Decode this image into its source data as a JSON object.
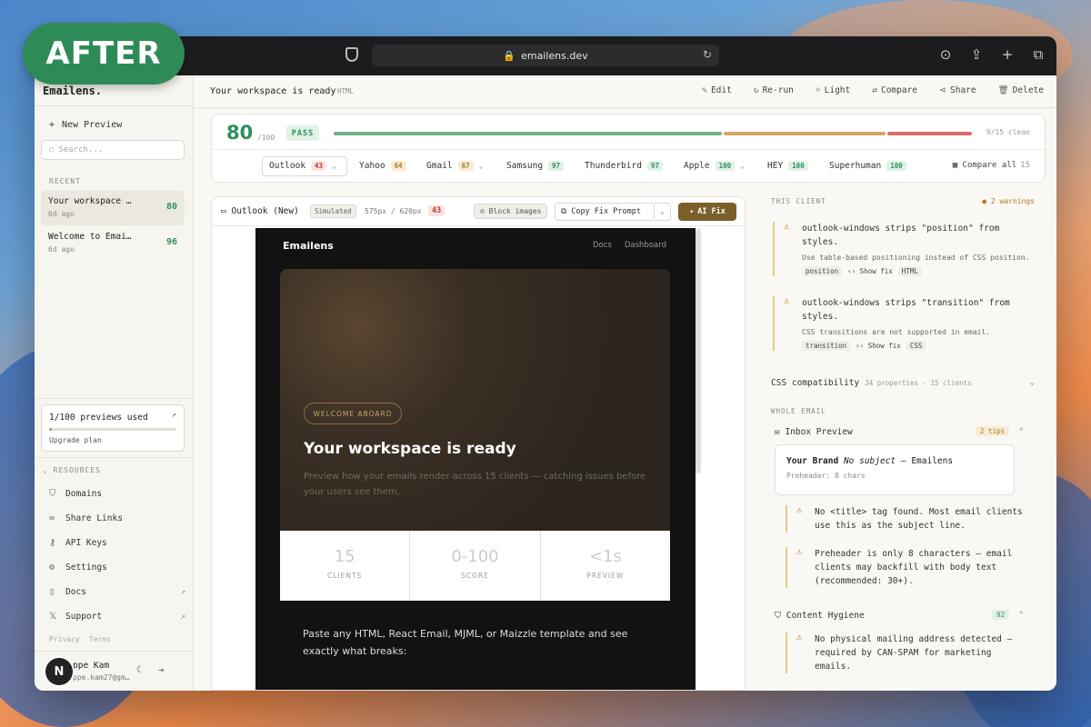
{
  "badge": "AFTER",
  "browser": {
    "url": "emailens.dev"
  },
  "sidebar": {
    "brand": "Emailens.",
    "new_preview": "New Preview",
    "search_placeholder": "Search...",
    "recent_label": "RECENT",
    "recent": [
      {
        "title": "Your workspace …",
        "date": "6d ago",
        "score": "80"
      },
      {
        "title": "Welcome to Emai…",
        "date": "6d ago",
        "score": "96"
      }
    ],
    "usage": {
      "text": "1/100 previews used",
      "upgrade": "Upgrade plan",
      "fraction": 0.01
    },
    "resources_label": "RESOURCES",
    "resources": [
      {
        "label": "Domains",
        "icon": "shield-icon"
      },
      {
        "label": "Share Links",
        "icon": "link-icon"
      },
      {
        "label": "API Keys",
        "icon": "key-icon"
      },
      {
        "label": "Settings",
        "icon": "gear-icon"
      },
      {
        "label": "Docs",
        "icon": "book-icon"
      },
      {
        "label": "Support",
        "icon": "x-icon"
      }
    ],
    "legal": [
      "Privacy",
      "Terms"
    ],
    "user": {
      "initial": "N",
      "name": "ppe Kam",
      "email": "ppe.kam27@gm…"
    }
  },
  "header": {
    "title": "Your workspace is ready",
    "type": "HTML",
    "actions": [
      "Edit",
      "Re-run",
      "Light",
      "Compare",
      "Share",
      "Delete"
    ]
  },
  "score": {
    "value": "80",
    "of": "/100",
    "status": "PASS",
    "clean": "9/15 clean",
    "segments": [
      {
        "fraction": 0.6,
        "color": "#6fb08a"
      },
      {
        "fraction": 0.25,
        "color": "#d4a862"
      },
      {
        "fraction": 0.13,
        "color": "#e06a66"
      }
    ],
    "clients": [
      {
        "name": "Outlook",
        "score": "43",
        "level": "red"
      },
      {
        "name": "Yahoo",
        "score": "64",
        "level": "amber"
      },
      {
        "name": "Gmail",
        "score": "67",
        "level": "amber"
      },
      {
        "name": "Samsung",
        "score": "97",
        "level": "green"
      },
      {
        "name": "Thunderbird",
        "score": "97",
        "level": "green"
      },
      {
        "name": "Apple",
        "score": "100",
        "level": "green"
      },
      {
        "name": "HEY",
        "score": "100",
        "level": "green"
      },
      {
        "name": "Superhuman",
        "score": "100",
        "level": "green"
      }
    ],
    "compare_all": "Compare all",
    "compare_count": "15"
  },
  "preview": {
    "client": "Outlook (New)",
    "mode": "Simulated",
    "size": "575px / 620px",
    "score": "43",
    "block_images": "Block images",
    "copy_fix": "Copy Fix Prompt",
    "ai_fix": "AI Fix"
  },
  "email": {
    "brand": "Emailens",
    "nav": [
      "Docs",
      "Dashboard"
    ],
    "badge": "WELCOME ABOARD",
    "headline": "Your workspace is ready",
    "sub": "Preview how your emails render across 15 clients — catching issues before your users see them.",
    "stats": [
      {
        "value": "15",
        "label": "CLIENTS"
      },
      {
        "value": "0-100",
        "label": "SCORE"
      },
      {
        "value": "<1s",
        "label": "PREVIEW"
      }
    ],
    "body": "Paste any HTML, React Email, MJML, or Maizzle template and see exactly what breaks:"
  },
  "panel": {
    "this_client": "THIS CLIENT",
    "warnings": "2 warnings",
    "issues": [
      {
        "title": "outlook-windows strips \"position\" from styles.",
        "sub": "Use table-based positioning instead of CSS position.",
        "tag": "position",
        "fix": "Show fix",
        "lang": "HTML"
      },
      {
        "title": "outlook-windows strips \"transition\" from styles.",
        "sub": "CSS transitions are not supported in email.",
        "tag": "transition",
        "fix": "Show fix",
        "lang": "CSS"
      }
    ],
    "css_compat": "CSS compatibility",
    "css_meta": "34 properties · 15 clients",
    "whole_email": "WHOLE EMAIL",
    "inbox_preview": "Inbox Preview",
    "inbox_tips": "2 tips",
    "inbox": {
      "brand": "Your Brand",
      "subject": "No subject",
      "sender": "— Emailens",
      "preheader": "Preheader: 8 chars"
    },
    "tips": [
      "No <title> tag found. Most email clients use this as the subject line.",
      "Preheader is only 8 characters — email clients may backfill with body text (recommended: 30+)."
    ],
    "hygiene": "Content Hygiene",
    "hygiene_score": "92",
    "hygiene_issue": "No physical mailing address detected — required by CAN-SPAM for marketing emails."
  }
}
